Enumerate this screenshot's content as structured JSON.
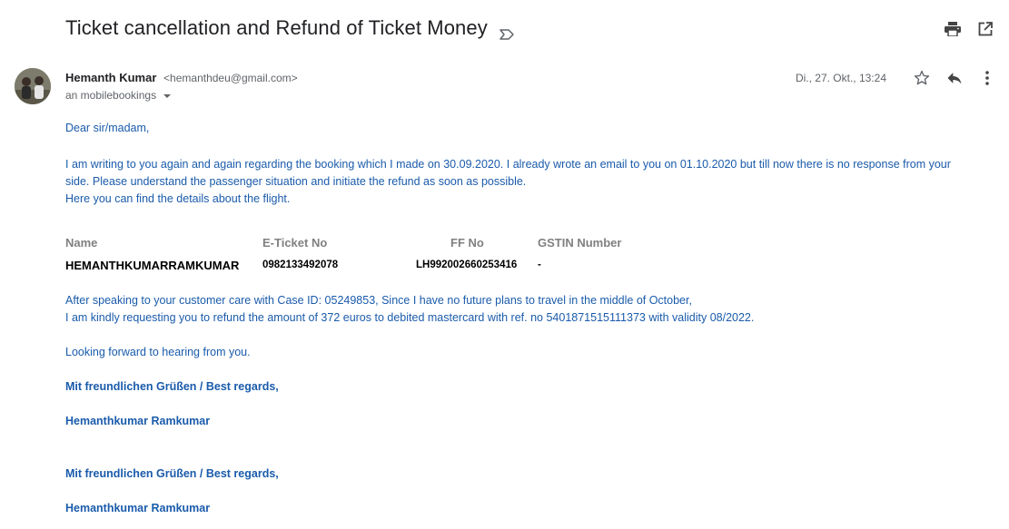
{
  "email": {
    "subject": "Ticket cancellation and Refund of Ticket Money",
    "sender_name": "Hemanth Kumar",
    "sender_email": "<hemanthdeu@gmail.com>",
    "recipient": "an mobilebookings",
    "date": "Di., 27. Okt., 13:24"
  },
  "icons": {
    "label": "label-important-icon",
    "print": "print-icon",
    "open_new": "open-in-new-window-icon",
    "star": "star-icon",
    "reply": "reply-icon",
    "more": "more-vert-icon"
  },
  "body": {
    "greeting": "Dear sir/madam,",
    "para1_line1": "I am writing to you again and again regarding the booking which I made on 30.09.2020. I already wrote an email to you on 01.10.2020 but till now there is no response from your",
    "para1_line2": "side. Please understand the passenger situation and initiate the refund as soon as possible.",
    "para1_line3": "Here you can find the details about the flight.",
    "table": {
      "headers": [
        "Name",
        "E-Ticket No",
        "FF No",
        "GSTIN Number"
      ],
      "row": [
        "HEMANTHKUMARRAMKUMAR",
        "0982133492078",
        "LH992002660253416",
        "-"
      ]
    },
    "para2_line1": "After speaking to your customer care with Case ID: 05249853, Since I have no future plans to travel in the middle of October,",
    "para2_line2": "I am kindly requesting you to refund the amount of 372 euros to debited mastercard with ref. no 5401871515111373 with validity 08/2022.",
    "para3": "Looking forward to hearing from you.",
    "sig1_regards": "Mit freundlichen Grüßen / Best regards,",
    "sig1_name": "Hemanthkumar Ramkumar",
    "sig2_regards": "Mit freundlichen Grüßen / Best regards,",
    "sig2_name": "Hemanthkumar Ramkumar"
  }
}
